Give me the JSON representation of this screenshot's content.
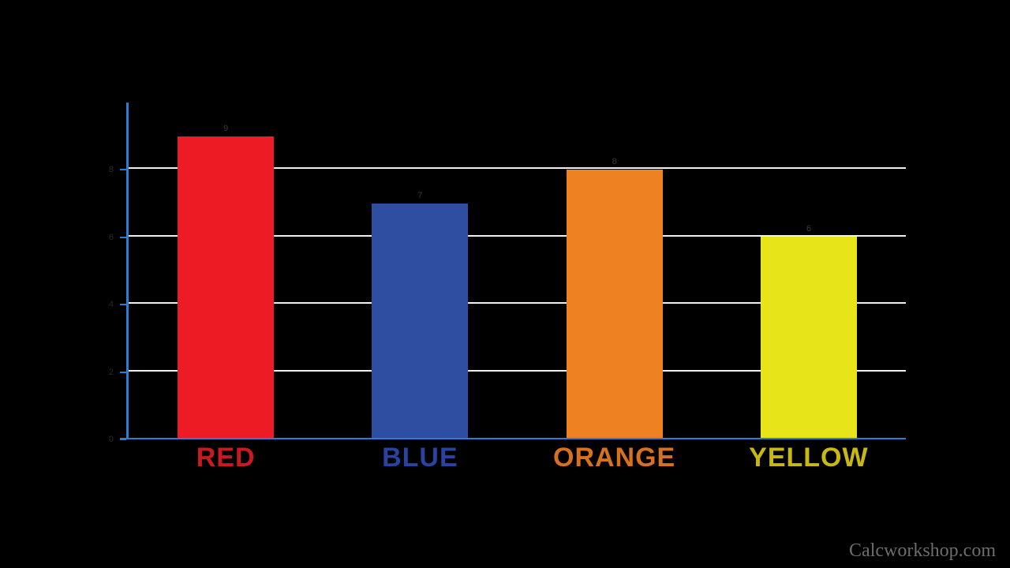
{
  "chart_data": {
    "type": "bar",
    "categories": [
      "RED",
      "BLUE",
      "ORANGE",
      "YELLOW"
    ],
    "values": [
      9,
      7,
      8,
      6
    ],
    "data_labels": [
      9,
      7,
      8,
      6
    ],
    "ylim": [
      0,
      10
    ],
    "y_ticks": [
      0,
      2,
      4,
      6,
      8
    ],
    "grid_at": [
      2,
      4,
      6,
      8
    ],
    "colors": {
      "RED": "#ed1c24",
      "BLUE": "#2e4ea1",
      "ORANGE": "#ee8222",
      "YELLOW": "#e7e41a"
    },
    "label_colors": {
      "RED": "#c81a1f",
      "BLUE": "#2843a0",
      "ORANGE": "#d8711b",
      "YELLOW": "#c9b90f"
    },
    "title": "",
    "xlabel": "",
    "ylabel": ""
  },
  "watermark": "Calcworkshop.com"
}
